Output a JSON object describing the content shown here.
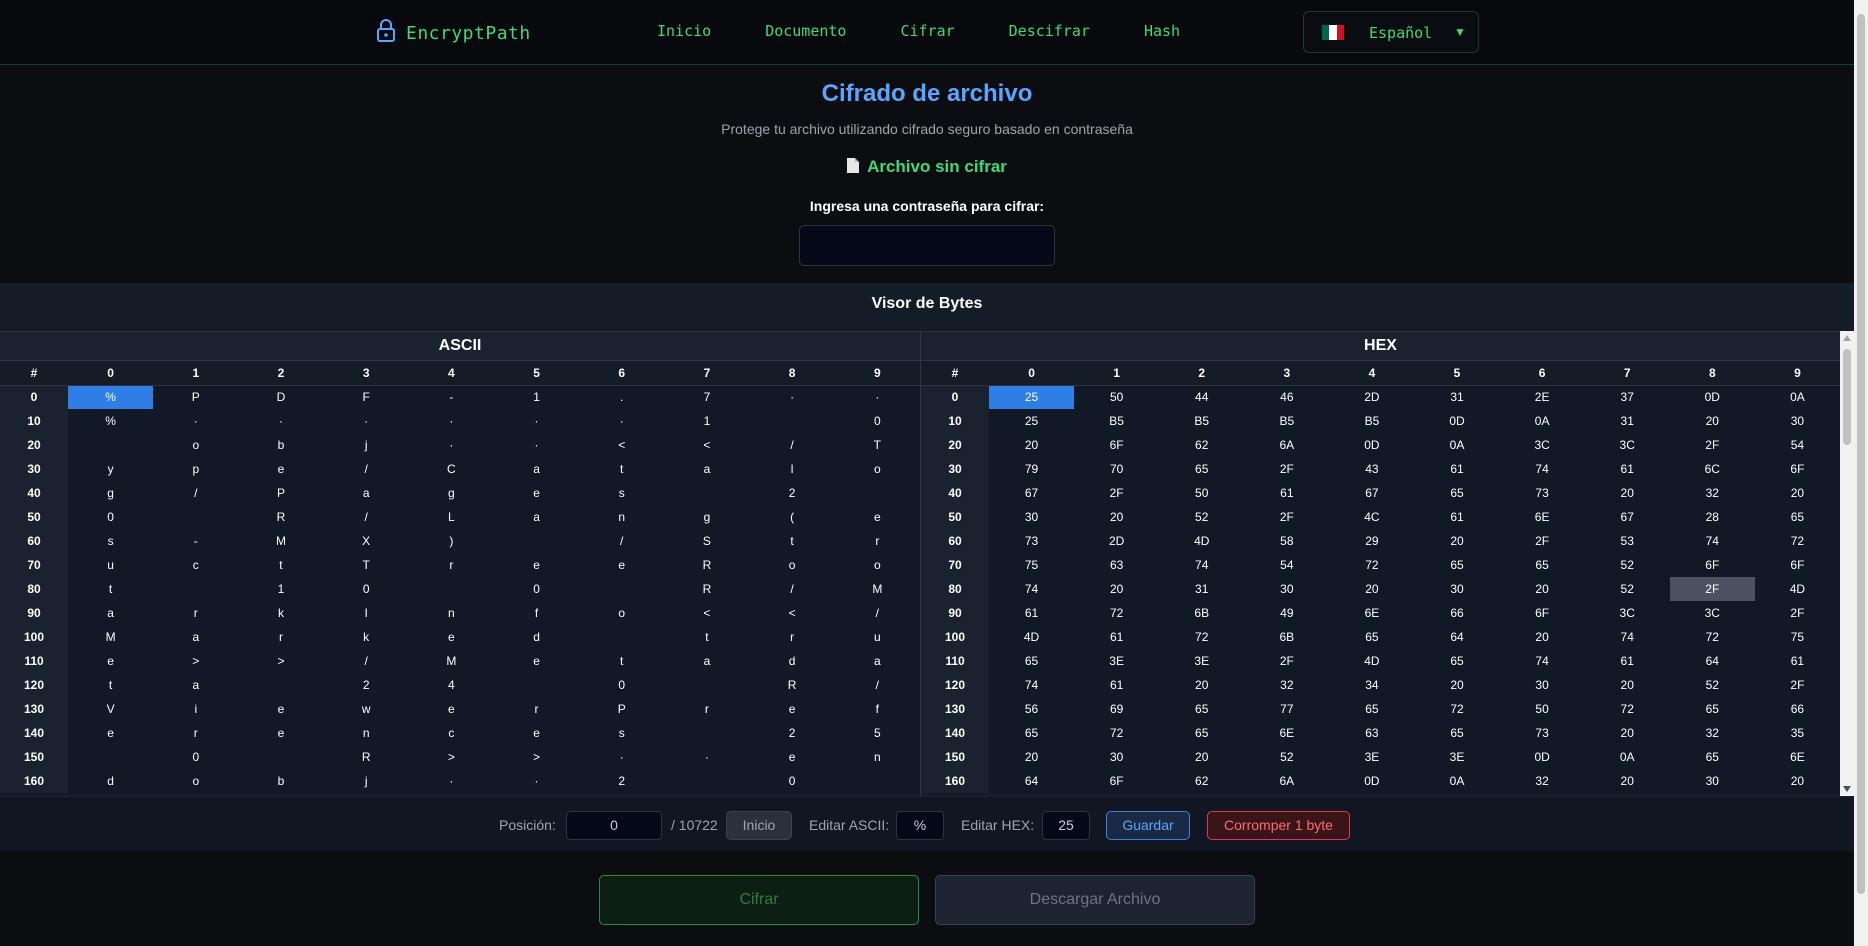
{
  "nav": {
    "brand": "EncryptPath",
    "links": [
      "Inicio",
      "Documento",
      "Cifrar",
      "Descifrar",
      "Hash"
    ],
    "language": "Español",
    "flag_colors": [
      "#006847",
      "#ffffff",
      "#ce1126"
    ]
  },
  "header": {
    "title": "Cifrado de archivo",
    "subtitle": "Protege tu archivo utilizando cifrado seguro basado en contraseña",
    "status": "Archivo sin cifrar",
    "password_label": "Ingresa una contraseña para cifrar:",
    "password_value": ""
  },
  "viewer": {
    "title": "Visor de Bytes",
    "ascii_title": "ASCII",
    "hex_title": "HEX",
    "column_headers": [
      "#",
      "0",
      "1",
      "2",
      "3",
      "4",
      "5",
      "6",
      "7",
      "8",
      "9"
    ],
    "selected_cell": {
      "row": 0,
      "col": 0
    },
    "highlighted_cell": {
      "row": 80,
      "col": 8
    },
    "ascii_rows": [
      {
        "offset": "0",
        "cells": [
          "%",
          "P",
          "D",
          "F",
          "-",
          "1",
          ".",
          "7",
          "·",
          "·"
        ]
      },
      {
        "offset": "10",
        "cells": [
          "%",
          "·",
          "·",
          "·",
          "·",
          "·",
          "·",
          "1",
          "",
          "0"
        ]
      },
      {
        "offset": "20",
        "cells": [
          "",
          "o",
          "b",
          "j",
          "·",
          "·",
          "<",
          "<",
          "/",
          "T"
        ]
      },
      {
        "offset": "30",
        "cells": [
          "y",
          "p",
          "e",
          "/",
          "C",
          "a",
          "t",
          "a",
          "l",
          "o"
        ]
      },
      {
        "offset": "40",
        "cells": [
          "g",
          "/",
          "P",
          "a",
          "g",
          "e",
          "s",
          "",
          "2",
          ""
        ]
      },
      {
        "offset": "50",
        "cells": [
          "0",
          "",
          "R",
          "/",
          "L",
          "a",
          "n",
          "g",
          "(",
          "e"
        ]
      },
      {
        "offset": "60",
        "cells": [
          "s",
          "-",
          "M",
          "X",
          ")",
          "",
          "/",
          "S",
          "t",
          "r"
        ]
      },
      {
        "offset": "70",
        "cells": [
          "u",
          "c",
          "t",
          "T",
          "r",
          "e",
          "e",
          "R",
          "o",
          "o"
        ]
      },
      {
        "offset": "80",
        "cells": [
          "t",
          "",
          "1",
          "0",
          "",
          "0",
          "",
          "R",
          "/",
          "M"
        ]
      },
      {
        "offset": "90",
        "cells": [
          "a",
          "r",
          "k",
          "I",
          "n",
          "f",
          "o",
          "<",
          "<",
          "/"
        ]
      },
      {
        "offset": "100",
        "cells": [
          "M",
          "a",
          "r",
          "k",
          "e",
          "d",
          "",
          "t",
          "r",
          "u"
        ]
      },
      {
        "offset": "110",
        "cells": [
          "e",
          ">",
          ">",
          "/",
          "M",
          "e",
          "t",
          "a",
          "d",
          "a"
        ]
      },
      {
        "offset": "120",
        "cells": [
          "t",
          "a",
          "",
          "2",
          "4",
          "",
          "0",
          "",
          "R",
          "/"
        ]
      },
      {
        "offset": "130",
        "cells": [
          "V",
          "i",
          "e",
          "w",
          "e",
          "r",
          "P",
          "r",
          "e",
          "f"
        ]
      },
      {
        "offset": "140",
        "cells": [
          "e",
          "r",
          "e",
          "n",
          "c",
          "e",
          "s",
          "",
          "2",
          "5"
        ]
      },
      {
        "offset": "150",
        "cells": [
          "",
          "0",
          "",
          "R",
          ">",
          ">",
          "·",
          "·",
          "e",
          "n"
        ]
      },
      {
        "offset": "160",
        "cells": [
          "d",
          "o",
          "b",
          "j",
          "·",
          "·",
          "2",
          "",
          "0",
          ""
        ]
      }
    ],
    "hex_rows": [
      {
        "offset": "0",
        "cells": [
          "25",
          "50",
          "44",
          "46",
          "2D",
          "31",
          "2E",
          "37",
          "0D",
          "0A"
        ]
      },
      {
        "offset": "10",
        "cells": [
          "25",
          "B5",
          "B5",
          "B5",
          "B5",
          "0D",
          "0A",
          "31",
          "20",
          "30"
        ]
      },
      {
        "offset": "20",
        "cells": [
          "20",
          "6F",
          "62",
          "6A",
          "0D",
          "0A",
          "3C",
          "3C",
          "2F",
          "54"
        ]
      },
      {
        "offset": "30",
        "cells": [
          "79",
          "70",
          "65",
          "2F",
          "43",
          "61",
          "74",
          "61",
          "6C",
          "6F"
        ]
      },
      {
        "offset": "40",
        "cells": [
          "67",
          "2F",
          "50",
          "61",
          "67",
          "65",
          "73",
          "20",
          "32",
          "20"
        ]
      },
      {
        "offset": "50",
        "cells": [
          "30",
          "20",
          "52",
          "2F",
          "4C",
          "61",
          "6E",
          "67",
          "28",
          "65"
        ]
      },
      {
        "offset": "60",
        "cells": [
          "73",
          "2D",
          "4D",
          "58",
          "29",
          "20",
          "2F",
          "53",
          "74",
          "72"
        ]
      },
      {
        "offset": "70",
        "cells": [
          "75",
          "63",
          "74",
          "54",
          "72",
          "65",
          "65",
          "52",
          "6F",
          "6F"
        ]
      },
      {
        "offset": "80",
        "cells": [
          "74",
          "20",
          "31",
          "30",
          "20",
          "30",
          "20",
          "52",
          "2F",
          "4D"
        ]
      },
      {
        "offset": "90",
        "cells": [
          "61",
          "72",
          "6B",
          "49",
          "6E",
          "66",
          "6F",
          "3C",
          "3C",
          "2F"
        ]
      },
      {
        "offset": "100",
        "cells": [
          "4D",
          "61",
          "72",
          "6B",
          "65",
          "64",
          "20",
          "74",
          "72",
          "75"
        ]
      },
      {
        "offset": "110",
        "cells": [
          "65",
          "3E",
          "3E",
          "2F",
          "4D",
          "65",
          "74",
          "61",
          "64",
          "61"
        ]
      },
      {
        "offset": "120",
        "cells": [
          "74",
          "61",
          "20",
          "32",
          "34",
          "20",
          "30",
          "20",
          "52",
          "2F"
        ]
      },
      {
        "offset": "130",
        "cells": [
          "56",
          "69",
          "65",
          "77",
          "65",
          "72",
          "50",
          "72",
          "65",
          "66"
        ]
      },
      {
        "offset": "140",
        "cells": [
          "65",
          "72",
          "65",
          "6E",
          "63",
          "65",
          "73",
          "20",
          "32",
          "35"
        ]
      },
      {
        "offset": "150",
        "cells": [
          "20",
          "30",
          "20",
          "52",
          "3E",
          "3E",
          "0D",
          "0A",
          "65",
          "6E"
        ]
      },
      {
        "offset": "160",
        "cells": [
          "64",
          "6F",
          "62",
          "6A",
          "0D",
          "0A",
          "32",
          "20",
          "30",
          "20"
        ]
      }
    ]
  },
  "controls": {
    "position_label": "Posición:",
    "position_value": "0",
    "position_total": "/ 10722",
    "start_button": "Inicio",
    "edit_ascii_label": "Editar ASCII:",
    "edit_ascii_value": "%",
    "edit_hex_label": "Editar HEX:",
    "edit_hex_value": "25",
    "save_button": "Guardar",
    "corrupt_button": "Corromper 1 byte"
  },
  "actions": {
    "encrypt_button": "Cifrar",
    "download_button": "Descargar Archivo"
  }
}
